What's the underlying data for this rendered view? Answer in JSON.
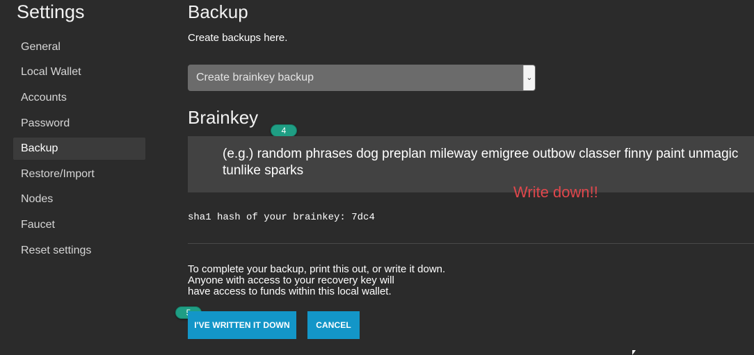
{
  "sidebar": {
    "title": "Settings",
    "items": [
      {
        "label": "General",
        "active": false
      },
      {
        "label": "Local Wallet",
        "active": false
      },
      {
        "label": "Accounts",
        "active": false
      },
      {
        "label": "Password",
        "active": false
      },
      {
        "label": "Backup",
        "active": true
      },
      {
        "label": "Restore/Import",
        "active": false
      },
      {
        "label": "Nodes",
        "active": false
      },
      {
        "label": "Faucet",
        "active": false
      },
      {
        "label": "Reset settings",
        "active": false
      }
    ]
  },
  "main": {
    "title": "Backup",
    "subtitle": "Create backups here.",
    "backup_type_select": {
      "value": "Create brainkey backup",
      "arrow": "chevron-down-icon"
    },
    "brainkey": {
      "title": "Brainkey",
      "phrase": "(e.g.) random phrases dog preplan mileway emigree outbow classer finny paint unmagic tunlike sparks",
      "hash_line": "sha1 hash of your brainkey: 7dc4"
    },
    "warning_lines": [
      "To complete your backup, print this out, or write it down.",
      "Anyone with access to your recovery key will",
      "have access to funds within this local wallet."
    ],
    "buttons": {
      "confirm_label": "I'VE WRITTEN IT DOWN",
      "cancel_label": "CANCEL"
    }
  },
  "annotations": {
    "step_badges": [
      "4",
      "5"
    ],
    "note": "Write down!!",
    "note_color": "#e0474c",
    "badge_color": "#1f9e84"
  },
  "colors": {
    "background": "#2b2b2b",
    "button": "#1396c8",
    "brainkey_box": "#424242",
    "active_item": "#3b3b3b"
  }
}
